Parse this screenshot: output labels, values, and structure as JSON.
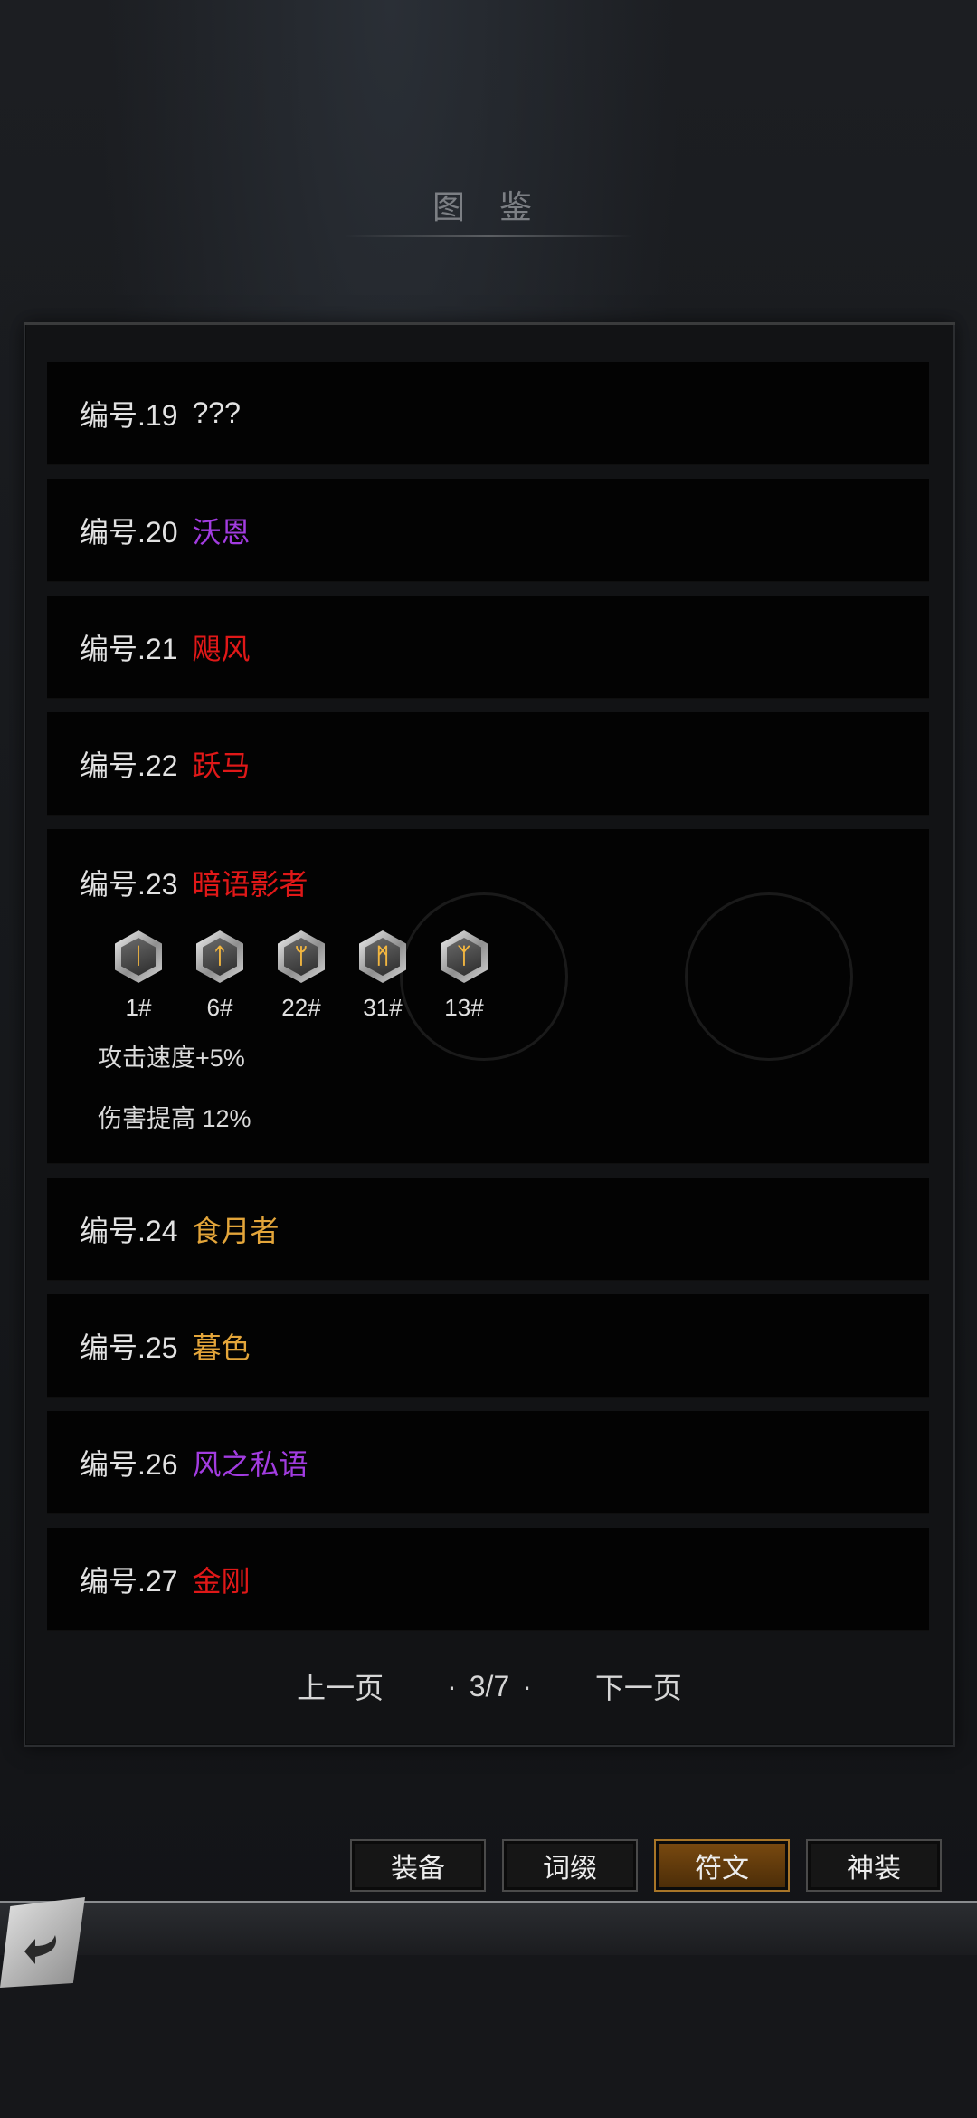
{
  "title": "图 鉴",
  "list": [
    {
      "num": "编号.19",
      "name": "???",
      "color": "#e2e2e2"
    },
    {
      "num": "编号.20",
      "name": "沃恩",
      "color": "#a23ce0"
    },
    {
      "num": "编号.21",
      "name": "飓风",
      "color": "#e01818"
    },
    {
      "num": "编号.22",
      "name": "跃马",
      "color": "#e01818"
    },
    {
      "num": "编号.23",
      "name": "暗语影者",
      "color": "#e01818",
      "runes": [
        {
          "label": "1#",
          "glyph": "ᛁ"
        },
        {
          "label": "6#",
          "glyph": "ᛏ"
        },
        {
          "label": "22#",
          "glyph": "ᛘ"
        },
        {
          "label": "31#",
          "glyph": "ᛗ"
        },
        {
          "label": "13#",
          "glyph": "ᛉ"
        }
      ],
      "stats": [
        "攻击速度+5%",
        "伤害提高 12%"
      ]
    },
    {
      "num": "编号.24",
      "name": "食月者",
      "color": "#e3a53a"
    },
    {
      "num": "编号.25",
      "name": "暮色",
      "color": "#e3a53a"
    },
    {
      "num": "编号.26",
      "name": "风之私语",
      "color": "#a23ce0"
    },
    {
      "num": "编号.27",
      "name": "金刚",
      "color": "#e01818"
    }
  ],
  "pager": {
    "prev": "上一页",
    "page": "3/7",
    "next": "下一页"
  },
  "tabs": [
    {
      "label": "装备",
      "active": false
    },
    {
      "label": "词缀",
      "active": false
    },
    {
      "label": "符文",
      "active": true
    },
    {
      "label": "神装",
      "active": false
    }
  ],
  "icons": {
    "back": "back-arrow-icon"
  }
}
